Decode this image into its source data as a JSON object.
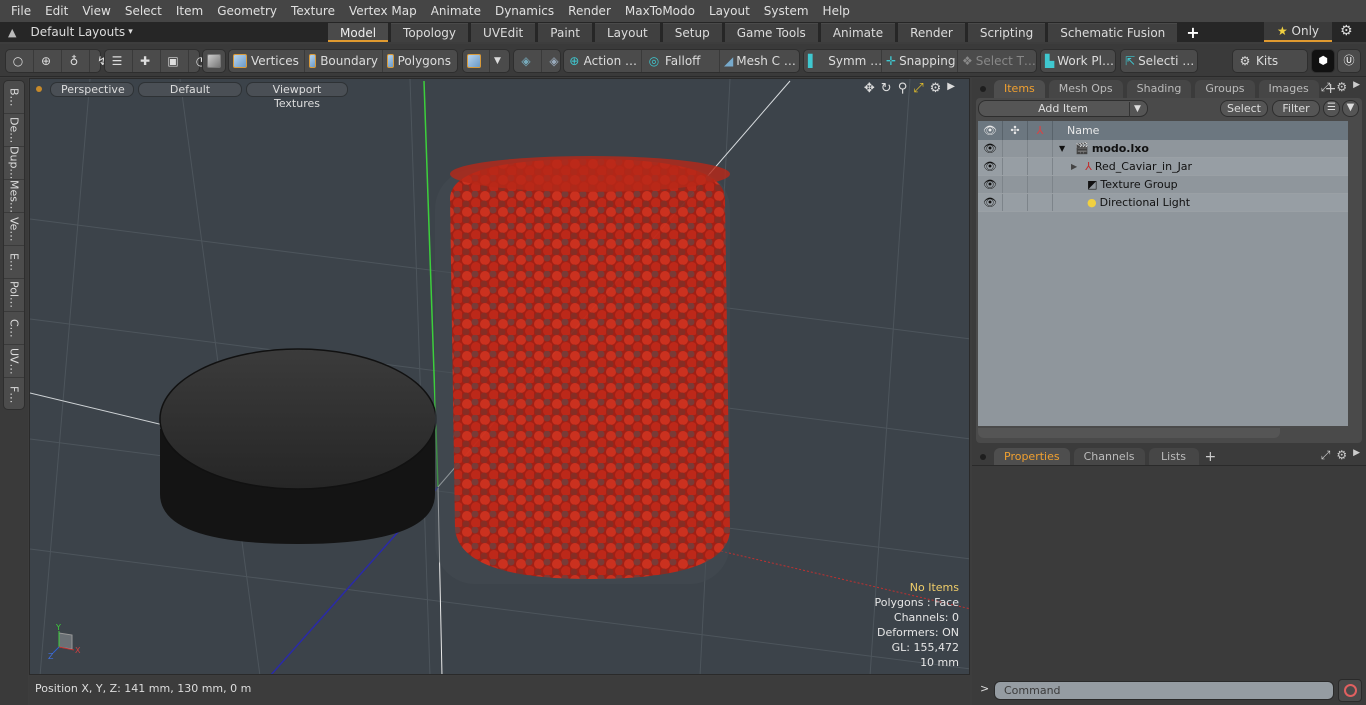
{
  "menu": [
    "File",
    "Edit",
    "View",
    "Select",
    "Item",
    "Geometry",
    "Texture",
    "Vertex Map",
    "Animate",
    "Dynamics",
    "Render",
    "MaxToModo",
    "Layout",
    "System",
    "Help"
  ],
  "layouts": {
    "label": "Default Layouts",
    "caret": "▾"
  },
  "layout_tabs": [
    {
      "label": "Model",
      "active": true
    },
    {
      "label": "Topology"
    },
    {
      "label": "UVEdit"
    },
    {
      "label": "Paint"
    },
    {
      "label": "Layout"
    },
    {
      "label": "Setup"
    },
    {
      "label": "Game Tools"
    },
    {
      "label": "Animate"
    },
    {
      "label": "Render"
    },
    {
      "label": "Scripting"
    },
    {
      "label": "Schematic Fusion"
    }
  ],
  "only_label": "Only",
  "toolbar": {
    "vertices": "Vertices",
    "boundary": "Boundary",
    "polygons": "Polygons",
    "action": "Action   …",
    "falloff": "Falloff",
    "mesh": "Mesh C …",
    "symm": "Symm …",
    "snapping": "Snapping",
    "select_t": "Select T…",
    "workplane": "Work Pl…",
    "selecti": "Selecti …",
    "kits": "Kits"
  },
  "left_tabs": [
    "B…",
    "De…",
    "Dup…",
    "Mes…",
    "Ve…",
    "E…",
    "Pol…",
    "C…",
    "UV…",
    "F…"
  ],
  "viewport": {
    "view": "Perspective",
    "shading": "Default",
    "textures": "Viewport Textures",
    "stats": {
      "selection": "No Items",
      "polygons": "Polygons : Face",
      "channels": "Channels: 0",
      "deformers": "Deformers: ON",
      "gl": "GL: 155,472",
      "unit": "10 mm"
    },
    "gizmo": {
      "x": "X",
      "y": "Y",
      "z": "Z"
    },
    "colors": {
      "caviar": "#d42a16",
      "lid": "#1c1c1c",
      "bg": "#3c434a"
    }
  },
  "status": {
    "position": "Position X, Y, Z:   141 mm, 130 mm, 0 m"
  },
  "items_panel": {
    "tabs": [
      {
        "label": "Items",
        "active": true
      },
      {
        "label": "Mesh Ops"
      },
      {
        "label": "Shading"
      },
      {
        "label": "Groups"
      },
      {
        "label": "Images"
      }
    ],
    "add_item": "Add Item",
    "select": "Select",
    "filter": "Filter",
    "name_col": "Name",
    "tree": [
      {
        "name": "modo.lxo",
        "bold": true,
        "icon": "scene-icon",
        "expand": "▼"
      },
      {
        "name": "Red_Caviar_in_Jar",
        "icon": "mesh-locator-icon",
        "expand": "▶"
      },
      {
        "name": "Texture Group",
        "icon": "texture-group-icon",
        "expand": ""
      },
      {
        "name": "Directional Light",
        "icon": "light-icon",
        "expand": ""
      }
    ]
  },
  "props_panel": {
    "tabs": [
      {
        "label": "Properties",
        "active": true
      },
      {
        "label": "Channels"
      },
      {
        "label": "Lists"
      }
    ]
  },
  "command": {
    "prompt": ">",
    "placeholder": "Command"
  }
}
